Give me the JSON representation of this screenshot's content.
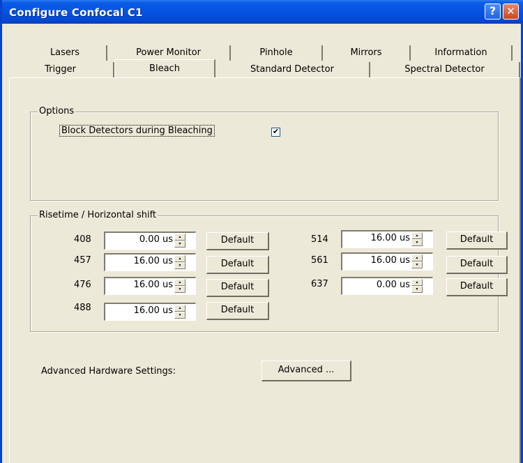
{
  "window": {
    "title": "Configure Confocal C1",
    "help_symbol": "?",
    "close_symbol": "✕"
  },
  "tabs": {
    "row1": [
      "Lasers",
      "Power Monitor",
      "Pinhole",
      "Mirrors",
      "Information"
    ],
    "row2": [
      "Trigger",
      "Bleach",
      "Standard Detector",
      "Spectral Detector"
    ],
    "active": "Bleach"
  },
  "options": {
    "group_label": "Options",
    "block_detectors_label": "Block Detectors during Bleaching",
    "block_detectors_checked": true,
    "check_mark": "✔"
  },
  "risetime": {
    "group_label": "Risetime / Horizontal shift",
    "default_label": "Default",
    "rows": [
      {
        "wavelength": "408",
        "value": "0.00 us"
      },
      {
        "wavelength": "457",
        "value": "16.00 us"
      },
      {
        "wavelength": "476",
        "value": "16.00 us"
      },
      {
        "wavelength": "488",
        "value": "16.00 us"
      },
      {
        "wavelength": "514",
        "value": "16.00 us"
      },
      {
        "wavelength": "561",
        "value": "16.00 us"
      },
      {
        "wavelength": "637",
        "value": "0.00 us"
      }
    ]
  },
  "advanced": {
    "label": "Advanced Hardware Settings:",
    "button_label": "Advanced ..."
  }
}
